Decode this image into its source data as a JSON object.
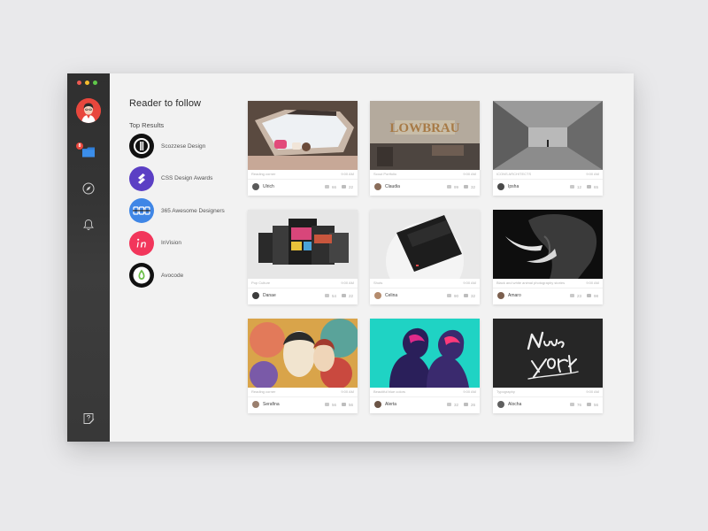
{
  "follow": {
    "title": "Reader to follow",
    "subtitle": "Top Results",
    "items": [
      {
        "label": "Scozzese Design"
      },
      {
        "label": "CSS Design Awards"
      },
      {
        "label": "365 Awesome Designers"
      },
      {
        "label": "InVision"
      },
      {
        "label": "Avocode"
      }
    ]
  },
  "sidebar": {
    "badge": "8"
  },
  "cards": [
    {
      "category": "Reading corner",
      "time": "9:00 AM",
      "user": "Ulrich",
      "likes": "66",
      "comments": "22"
    },
    {
      "category": "Scout Portfolio",
      "time": "9:00 AM",
      "user": "Claudia",
      "likes": "99",
      "comments": "32"
    },
    {
      "category": "ICONS ARCHITECTS",
      "time": "9:00 AM",
      "user": "Ipsha",
      "likes": "12",
      "comments": "65"
    },
    {
      "category": "Pop Culture",
      "time": "9:00 AM",
      "user": "Danae",
      "likes": "54",
      "comments": "22"
    },
    {
      "category": "Shots",
      "time": "9:00 AM",
      "user": "Celina",
      "likes": "90",
      "comments": "32"
    },
    {
      "category": "Black and white animal photography stories",
      "time": "9:00 AM",
      "user": "Amaro",
      "likes": "23",
      "comments": "98"
    },
    {
      "category": "Reading corner",
      "time": "9:00 AM",
      "user": "Serafina",
      "likes": "56",
      "comments": "56"
    },
    {
      "category": "Beautiful blue colors",
      "time": "9:00 AM",
      "user": "Alerta",
      "likes": "32",
      "comments": "26"
    },
    {
      "category": "Typography",
      "time": "9:00 AM",
      "user": "Alocha",
      "likes": "76",
      "comments": "56"
    }
  ],
  "colors": {
    "sidebar": "#353535",
    "avatar_red": "#e8473d",
    "folder_blue": "#2f7ed8",
    "traffic_red": "#ee5a52",
    "traffic_yellow": "#f5bd2e",
    "traffic_green": "#5fc84a"
  },
  "icons": [
    "user-avatar-icon",
    "folder-icon",
    "compass-icon",
    "bell-icon",
    "help-icon",
    "thumbs-up-icon",
    "comment-icon"
  ]
}
